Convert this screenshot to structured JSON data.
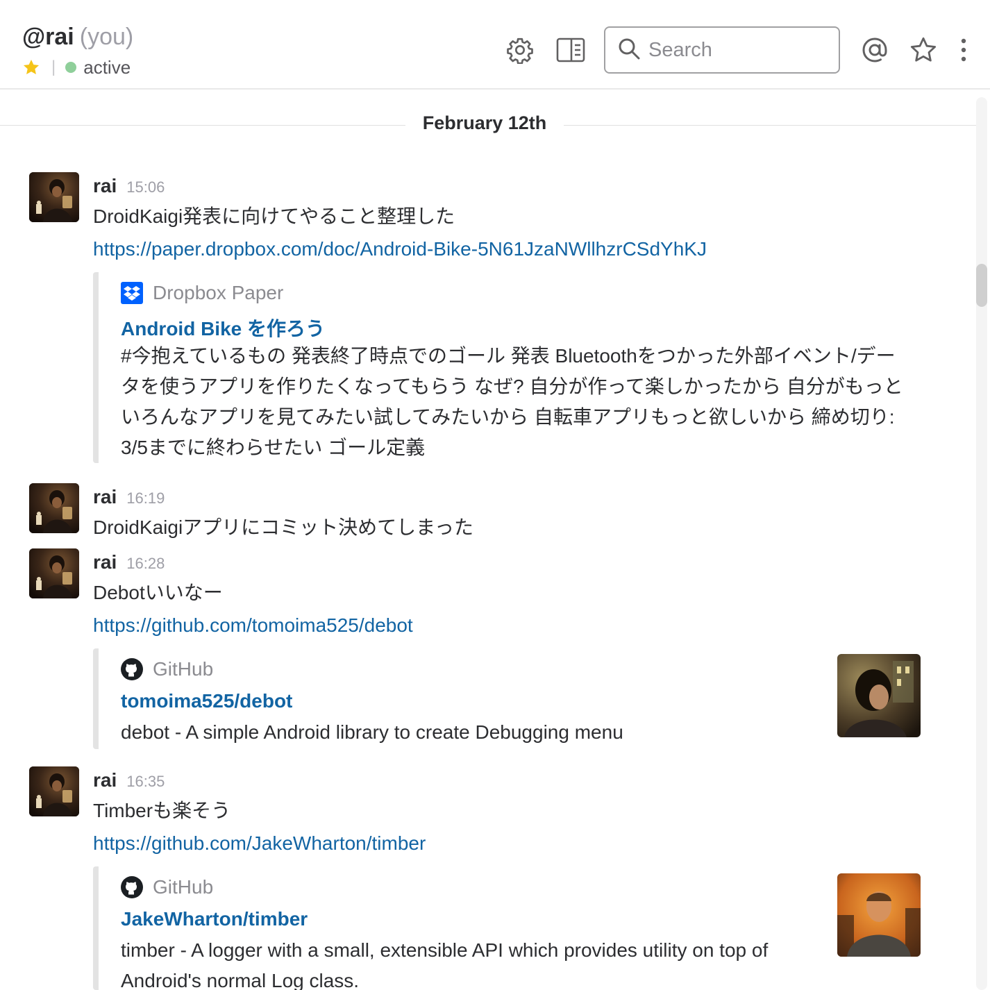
{
  "header": {
    "channel_name": "@rai",
    "you_label": "(you)",
    "presence": "active",
    "search_placeholder": "Search",
    "icons": [
      "settings-gear-icon",
      "details-pane-icon",
      "search-icon",
      "mentions-at-icon",
      "starred-items-icon",
      "more-vertical-icon"
    ]
  },
  "date_divider": "February 12th",
  "messages": [
    {
      "sender": "rai",
      "time": "15:06",
      "text": "DroidKaigi発表に向けてやること整理した",
      "link": "https://paper.dropbox.com/doc/Android-Bike-5N61JzaNWllhzrCSdYhKJ",
      "attachment": {
        "service": "Dropbox Paper",
        "title": "Android Bike を作ろう",
        "body": "#今抱えているもの 発表終了時点でのゴール 発表 Bluetoothをつかった外部イベント/データを使うアプリを作りたくなってもらう なぜ? 自分が作って楽しかったから 自分がもっといろんなアプリを見てみたい試してみたいから 自転車アプリもっと欲しいから 締め切り: 3/5までに終わらせたい ゴール定義"
      }
    },
    {
      "sender": "rai",
      "time": "16:19",
      "text": "DroidKaigiアプリにコミット決めてしまった"
    },
    {
      "sender": "rai",
      "time": "16:28",
      "text": "Debotいいなー",
      "link": "https://github.com/tomoima525/debot",
      "attachment": {
        "service": "GitHub",
        "title": "tomoima525/debot",
        "body": "debot - A simple Android library to create Debugging menu"
      }
    },
    {
      "sender": "rai",
      "time": "16:35",
      "text": "Timberも楽そう",
      "link": "https://github.com/JakeWharton/timber",
      "attachment": {
        "service": "GitHub",
        "title": "JakeWharton/timber",
        "body": "timber - A logger with a small, extensible API which provides utility on top of Android's normal Log class."
      }
    }
  ],
  "colors": {
    "link": "#1264a3",
    "presence_active": "#8fcf9a",
    "star": "#f5c419",
    "dropbox": "#0061fe"
  }
}
